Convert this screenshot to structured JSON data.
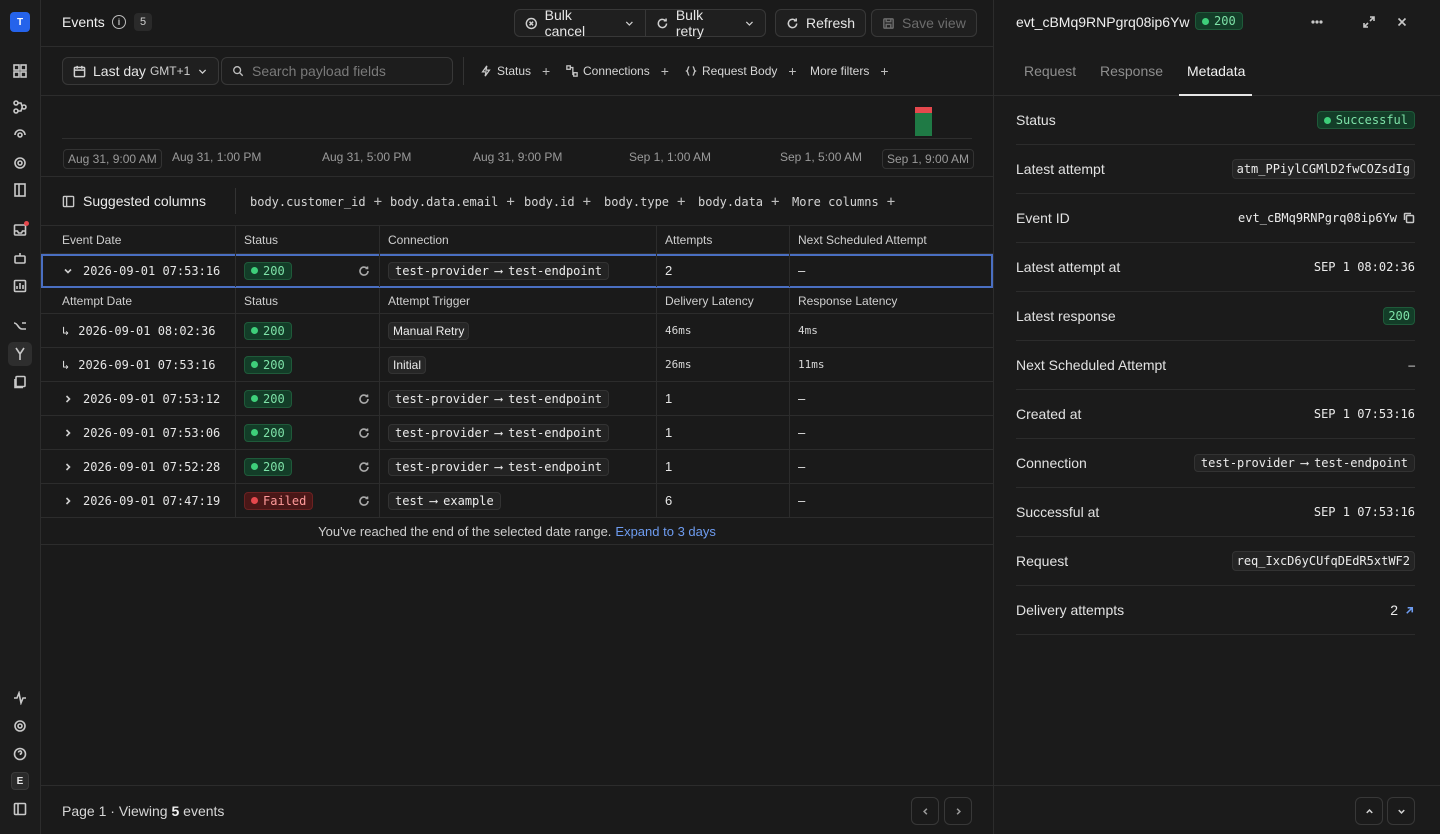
{
  "rail": {
    "team_initial": "T",
    "env_initial": "E"
  },
  "header": {
    "title": "Events",
    "count": "5",
    "bulk_cancel": "Bulk cancel",
    "bulk_retry": "Bulk retry",
    "refresh": "Refresh",
    "save_view": "Save view"
  },
  "filters": {
    "date_range": "Last day",
    "timezone": "GMT+1",
    "search_placeholder": "Search payload fields",
    "chips": [
      "Status",
      "Connections",
      "Request Body",
      "More filters"
    ]
  },
  "histogram": {
    "ticks": [
      "Aug 31, 9:00 AM",
      "Aug 31, 1:00 PM",
      "Aug 31, 5:00 PM",
      "Aug 31, 9:00 PM",
      "Sep 1, 1:00 AM",
      "Sep 1, 5:00 AM",
      "Sep 1, 9:00 AM"
    ]
  },
  "suggested": {
    "title": "Suggested columns",
    "columns": [
      "body.customer_id",
      "body.data.email",
      "body.id",
      "body.type",
      "body.data",
      "More columns"
    ]
  },
  "table": {
    "headers": [
      "Event Date",
      "Status",
      "Connection",
      "Attempts",
      "Next Scheduled Attempt"
    ],
    "attempt_headers": [
      "Attempt Date",
      "Status",
      "Attempt Trigger",
      "Delivery Latency",
      "Response Latency"
    ],
    "selected_event": {
      "date": "2026-09-01 07:53:16",
      "status": "200",
      "source": "test-provider",
      "destination": "test-endpoint",
      "attempts": "2",
      "next": "–"
    },
    "attempts": [
      {
        "date": "2026-09-01 08:02:36",
        "status": "200",
        "trigger": "Manual Retry",
        "delivery": "46ms",
        "response": "4ms"
      },
      {
        "date": "2026-09-01 07:53:16",
        "status": "200",
        "trigger": "Initial",
        "delivery": "26ms",
        "response": "11ms"
      }
    ],
    "events": [
      {
        "date": "2026-09-01 07:53:12",
        "status": "200",
        "source": "test-provider",
        "destination": "test-endpoint",
        "attempts": "1",
        "next": "–"
      },
      {
        "date": "2026-09-01 07:53:06",
        "status": "200",
        "source": "test-provider",
        "destination": "test-endpoint",
        "attempts": "1",
        "next": "–"
      },
      {
        "date": "2026-09-01 07:52:28",
        "status": "200",
        "source": "test-provider",
        "destination": "test-endpoint",
        "attempts": "1",
        "next": "–"
      },
      {
        "date": "2026-09-01 07:47:19",
        "status": "Failed",
        "source": "test",
        "destination": "example",
        "attempts": "6",
        "next": "–"
      }
    ],
    "end_message": "You've reached the end of the selected date range.",
    "expand_link": "Expand to 3 days"
  },
  "footer": {
    "page_text": "Page 1 · Viewing",
    "count": "5",
    "suffix": "events"
  },
  "panel": {
    "event_id": "evt_cBMq9RNPgrq08ip6Yw",
    "status_code": "200",
    "tabs": [
      "Request",
      "Response",
      "Metadata"
    ],
    "metadata": {
      "status_label": "Status",
      "status_value": "Successful",
      "latest_attempt_label": "Latest attempt",
      "latest_attempt_value": "atm_PPiylCGMlD2fwCOZsdIg",
      "event_id_label": "Event ID",
      "event_id_value": "evt_cBMq9RNPgrq08ip6Yw",
      "latest_attempt_at_label": "Latest attempt at",
      "latest_attempt_at_value": "SEP 1 08:02:36",
      "latest_response_label": "Latest response",
      "latest_response_value": "200",
      "next_scheduled_label": "Next Scheduled Attempt",
      "next_scheduled_value": "–",
      "created_at_label": "Created at",
      "created_at_value": "SEP 1 07:53:16",
      "connection_label": "Connection",
      "connection_source": "test-provider",
      "connection_destination": "test-endpoint",
      "successful_at_label": "Successful at",
      "successful_at_value": "SEP 1 07:53:16",
      "request_label": "Request",
      "request_value": "req_IxcD6yCUfqDEdR5xtWF2",
      "delivery_attempts_label": "Delivery attempts",
      "delivery_attempts_value": "2"
    }
  }
}
